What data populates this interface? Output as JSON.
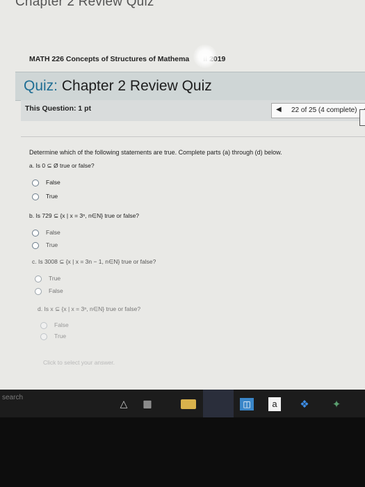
{
  "header": {
    "chapter_title": "Chapter 2 Review Quiz",
    "course_line": "MATH 226 Concepts of Structures of Mathema",
    "course_suffix": "ll 2019",
    "quiz_prefix": "Quiz:",
    "quiz_title": " Chapter 2 Review Quiz"
  },
  "question_bar": {
    "label": "This Question: 1 pt",
    "nav_text": "22 of 25 (4 complete)",
    "prev_icon": "◀",
    "dropdown_icon": "▼"
  },
  "question": {
    "prompt": "Determine which of the following statements are true. Complete parts (a) through (d) below.",
    "parts": [
      {
        "text": "a. Is 0 ⊆ Ø true or false?",
        "options": [
          "False",
          "True"
        ]
      },
      {
        "text": "b. Is 729 ⊆ {x | x = 3ⁿ, n∈N} true or false?",
        "options": [
          "False",
          "True"
        ]
      },
      {
        "text": "c. Is 3008 ⊆ {x | x = 3n − 1, n∈N} true or false?",
        "options": [
          "True",
          "False"
        ]
      },
      {
        "text": "d. Is x ⊆ {x | x = 3ⁿ, n∈N} true or false?",
        "options": [
          "False",
          "True"
        ]
      }
    ],
    "hint": "Click to select your answer."
  },
  "taskbar": {
    "search_text": "search",
    "icons": [
      "microphone-icon",
      "task-view-icon",
      "folder-icon",
      "edge-icon",
      "store-icon",
      "amazon-icon",
      "dropbox-icon",
      "app-icon"
    ],
    "amazon_label": "a"
  },
  "colors": {
    "quiz_accent": "#1f6e94",
    "header_bg": "#cfd6d6"
  }
}
